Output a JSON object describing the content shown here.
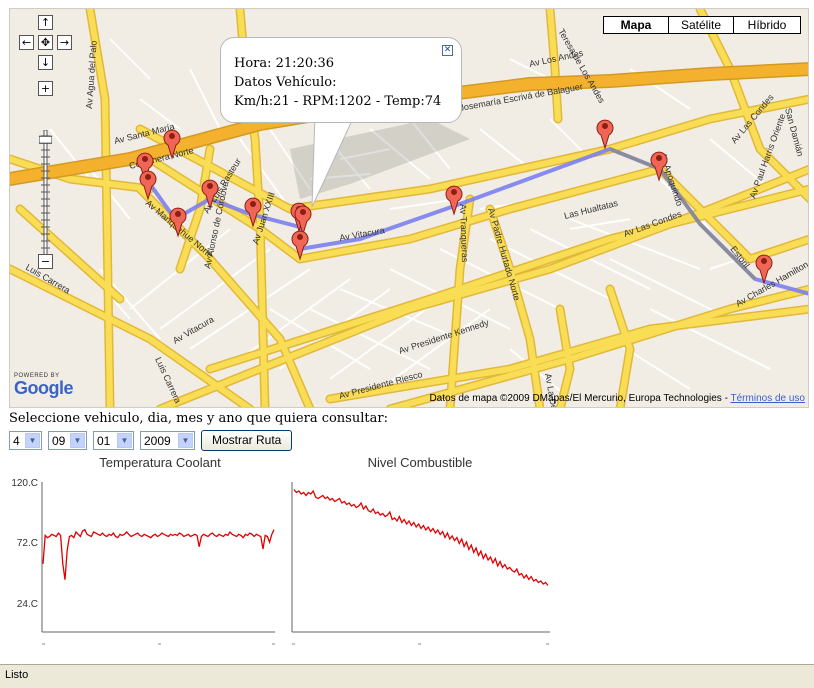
{
  "map": {
    "type_buttons": [
      {
        "label": "Mapa",
        "active": true
      },
      {
        "label": "Satélite",
        "active": false
      },
      {
        "label": "Híbrido",
        "active": false
      }
    ],
    "pan_labels": {
      "up": "↑",
      "left": "←",
      "center": "✥",
      "right": "→",
      "down": "↓"
    },
    "zoom_in": "+",
    "zoom_out": "−",
    "zoom_level_fraction": 0.05,
    "infowindow": {
      "line1": "Hora: 21:20:36",
      "line2": "Datos Vehículo:",
      "line3": "Km/h:21 - RPM:1202 - Temp:74",
      "close": "✕"
    },
    "street_labels": [
      "Av Santa María",
      "Costanera Norte",
      "Av Agua del Palo",
      "Av Luis Pasteur",
      "Av Juan XXIII",
      "Av Manquehue Norte",
      "Av Vitacura",
      "Las Hualtatas",
      "Av Padre Hurtado Norte",
      "Av Tranqueras",
      "Av Apoquindo",
      "Av Las Condes",
      "Av Paul Harris Oriente",
      "Estoril",
      "Av Charles Hamilton",
      "Av Presidente Kennedy",
      "Av Presidente Riesco",
      "Luis Carrera",
      "Av Alonso de Córdova",
      "Teresa de Los Andes",
      "Av Los Andes",
      "Josemaría Escrivá de Balaguer",
      "San Damián",
      "Av Las Condes",
      "Av Vitacura",
      "Luis Carrera",
      "Av La Dehesa"
    ],
    "powered_by": "POWERED BY",
    "logo_text": "Google",
    "copyright_text": "Datos de mapa ©2009 DMapas/El Mercurio, Europa Technologies -",
    "terms_link": "Términos de uso",
    "colors": {
      "road_major": "#f9dd55",
      "road_border": "#e2b83a",
      "highway": "#f3b12e",
      "route": "#7c80ee",
      "marker": "#f06656",
      "land": "#f1ede4"
    }
  },
  "form": {
    "prompt": "Seleccione vehiculo, dia, mes y ano que quiera consultar:",
    "vehicle": "4",
    "day": "09",
    "month": "01",
    "year": "2009",
    "button": "Mostrar Ruta"
  },
  "chart_data": [
    {
      "type": "line",
      "title": "Temperatura Coolant",
      "yticks": [
        "120.C",
        "72.C",
        "24.C"
      ],
      "ylim": [
        0,
        132
      ],
      "color": "#e00000",
      "values": [
        60,
        85,
        83,
        84,
        86,
        85,
        84,
        87,
        85,
        60,
        46,
        72,
        84,
        85,
        83,
        88,
        86,
        84,
        89,
        90,
        86,
        85,
        84,
        88,
        87,
        86,
        85,
        87,
        85,
        84,
        86,
        85,
        87,
        84,
        83,
        86,
        85,
        86,
        88,
        86,
        84,
        85,
        86,
        87,
        85,
        84,
        86,
        85,
        84,
        83,
        85,
        86,
        84,
        85,
        87,
        86,
        85,
        84,
        86,
        85,
        86,
        85,
        87,
        86,
        84,
        85,
        86,
        84,
        85,
        86,
        85,
        75,
        84,
        86,
        85,
        84,
        86,
        87,
        85,
        84,
        86,
        85,
        84,
        86,
        85,
        88,
        86,
        85,
        84,
        86,
        85,
        83,
        86,
        85,
        87,
        86,
        84,
        86,
        85,
        84,
        73,
        85,
        84,
        79,
        86,
        90
      ]
    },
    {
      "type": "line",
      "title": "Nivel Combustible",
      "color": "#e00000",
      "values": [
        95,
        93,
        94,
        92,
        93,
        91,
        93,
        92,
        94,
        90,
        89,
        90,
        91,
        89,
        90,
        88,
        89,
        87,
        88,
        89,
        86,
        87,
        85,
        86,
        84,
        85,
        83,
        84,
        86,
        82,
        84,
        81,
        80,
        82,
        79,
        80,
        78,
        79,
        77,
        78,
        80,
        75,
        76,
        74,
        77,
        73,
        75,
        72,
        74,
        71,
        73,
        70,
        72,
        69,
        71,
        68,
        70,
        67,
        69,
        66,
        68,
        65,
        67,
        63,
        66,
        62,
        64,
        61,
        63,
        59,
        62,
        57,
        60,
        55,
        58,
        53,
        56,
        51,
        54,
        49,
        52,
        48,
        50,
        46,
        49,
        44,
        47,
        43,
        45,
        42,
        43,
        41,
        40,
        42,
        38,
        39,
        36,
        38,
        35,
        37,
        34,
        35,
        33,
        34,
        32,
        33,
        31
      ]
    }
  ],
  "status": {
    "text": "Listo"
  }
}
